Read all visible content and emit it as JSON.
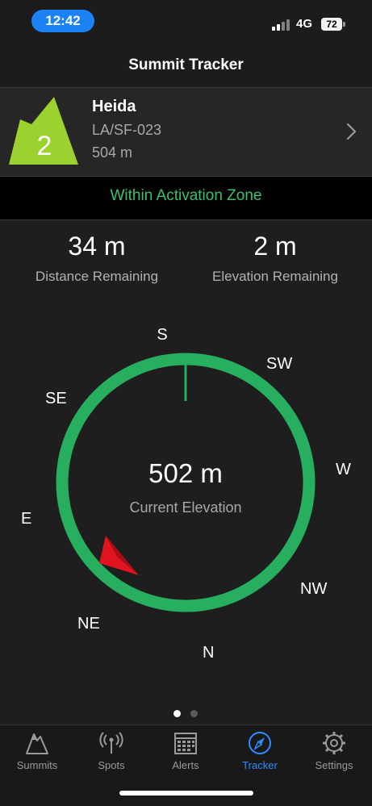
{
  "status_bar": {
    "time": "12:42",
    "network": "4G",
    "battery": "72",
    "accent_color": "#1a82f4"
  },
  "nav": {
    "title": "Summit Tracker"
  },
  "summit": {
    "points": "2",
    "name": "Heida",
    "reference": "LA/SF-023",
    "altitude": "504 m",
    "badge_color": "#9cd22f"
  },
  "zone": {
    "text": "Within Activation Zone",
    "color": "#3cc06a"
  },
  "stats": {
    "distance_value": "34 m",
    "distance_label": "Distance Remaining",
    "elevation_value": "2 m",
    "elevation_label": "Elevation Remaining"
  },
  "compass": {
    "directions": {
      "s": "S",
      "sw": "SW",
      "w": "W",
      "nw": "NW",
      "n": "N",
      "ne": "NE",
      "e": "E",
      "se": "SE"
    },
    "current_elevation_value": "502 m",
    "current_elevation_label": "Current Elevation",
    "ring_color": "#27ae5f",
    "needle_color": "#e0141e"
  },
  "pager": {
    "count": 2,
    "active_index": 0
  },
  "tabs": [
    {
      "label": "Summits",
      "icon": "mountain-icon"
    },
    {
      "label": "Spots",
      "icon": "antenna-icon"
    },
    {
      "label": "Alerts",
      "icon": "calendar-icon"
    },
    {
      "label": "Tracker",
      "icon": "compass-icon",
      "active": true
    },
    {
      "label": "Settings",
      "icon": "gear-icon"
    }
  ]
}
